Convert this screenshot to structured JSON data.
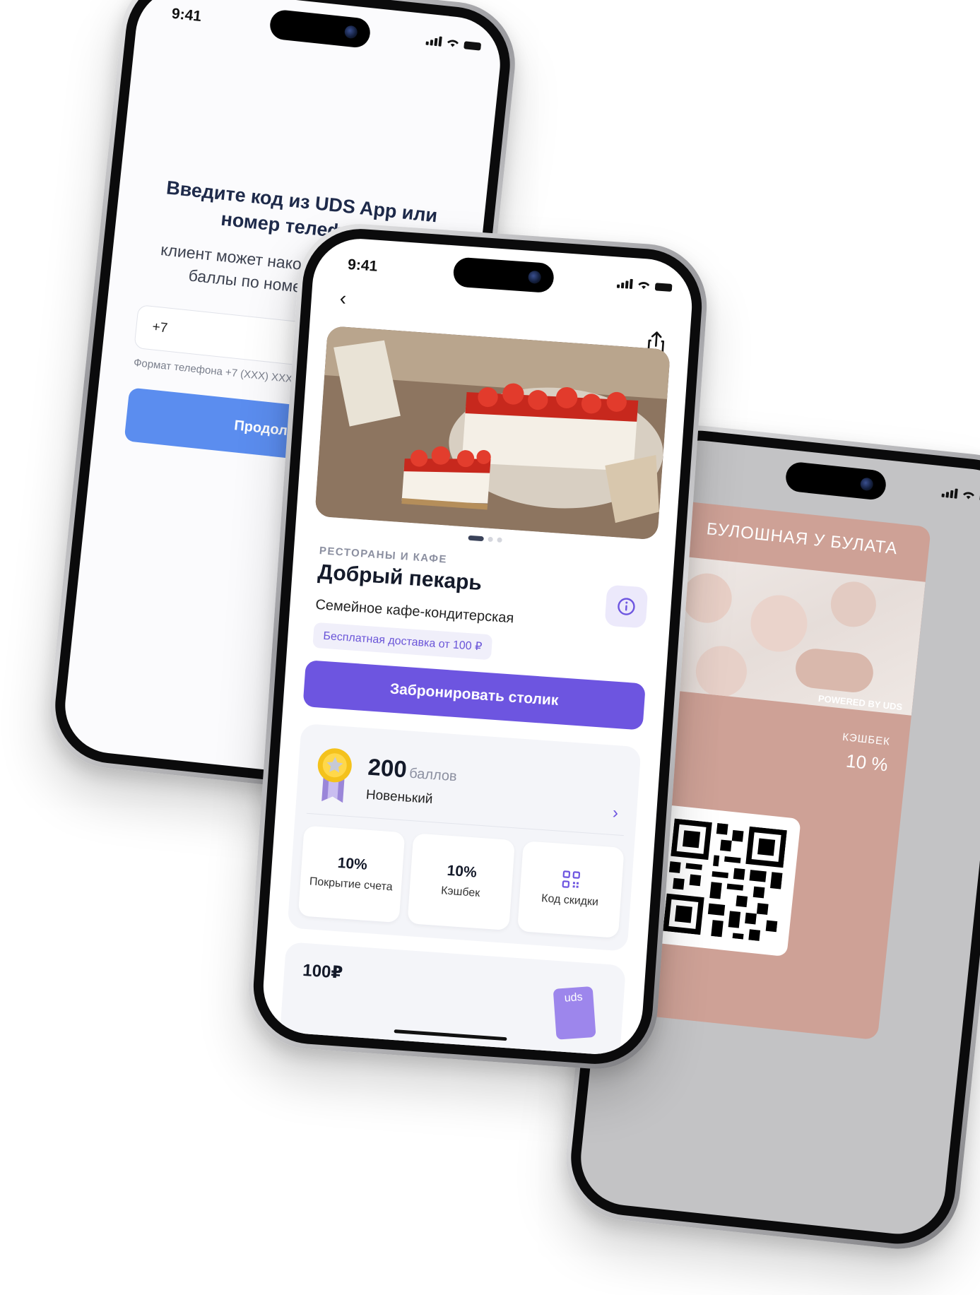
{
  "phone_left": {
    "time": "9:41",
    "title": "Введите код из UDS App или номер телефона",
    "subtitle": "клиент может накопить или списать баллы по номеру телефона",
    "phone_prefix": "+7",
    "hint": "Формат телефона +7 (XXX) XXX XX XX",
    "continue_label": "Продолжить"
  },
  "phone_center": {
    "time": "9:41",
    "category": "РЕСТОРАНЫ И КАФЕ",
    "name": "Добрый пекарь",
    "description": "Семейное кафе-кондитерская",
    "delivery": "Бесплатная доставка от 100 ₽",
    "book_label": "Забронировать столик",
    "points": "200",
    "points_unit": "баллов",
    "level": "Новенький",
    "tiles": [
      {
        "value": "10%",
        "label": "Покрытие счета"
      },
      {
        "value": "10%",
        "label": "Кэшбек"
      },
      {
        "value": "",
        "label": "Код скидки"
      }
    ],
    "promo_amount": "100₽",
    "promo_tag": "uds",
    "accent_color": "#6d55e0"
  },
  "phone_right": {
    "card_title": "БУЛОШНАЯ У БУЛАТА",
    "powered": "POWERED BY UDS",
    "cashback_label": "КЭШБЕК",
    "cashback_value": "10 %",
    "card_color": "#cea196"
  }
}
